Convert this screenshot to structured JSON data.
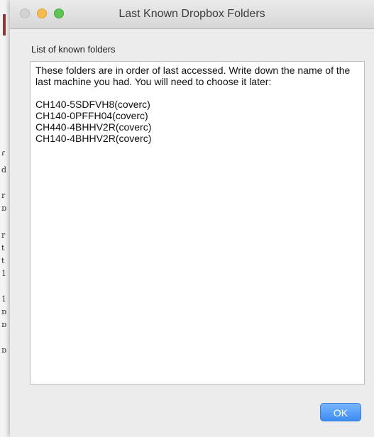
{
  "window": {
    "title": "Last Known Dropbox Folders"
  },
  "dialog": {
    "list_label": "List of known folders",
    "description": "These folders are in order of last accessed. Write down the name of the last machine you had. You will need to choose it later:",
    "folders": [
      "CH140-5SDFVH8(coverc)",
      "CH140-0PFFH04(coverc)",
      "CH440-4BHHV2R(coverc)",
      "CH140-4BHHV2R(coverc)"
    ],
    "ok_label": "OK"
  },
  "colors": {
    "accent": "#3d8cf2",
    "minimize": "#f5bd4f",
    "maximize": "#5fc453"
  }
}
